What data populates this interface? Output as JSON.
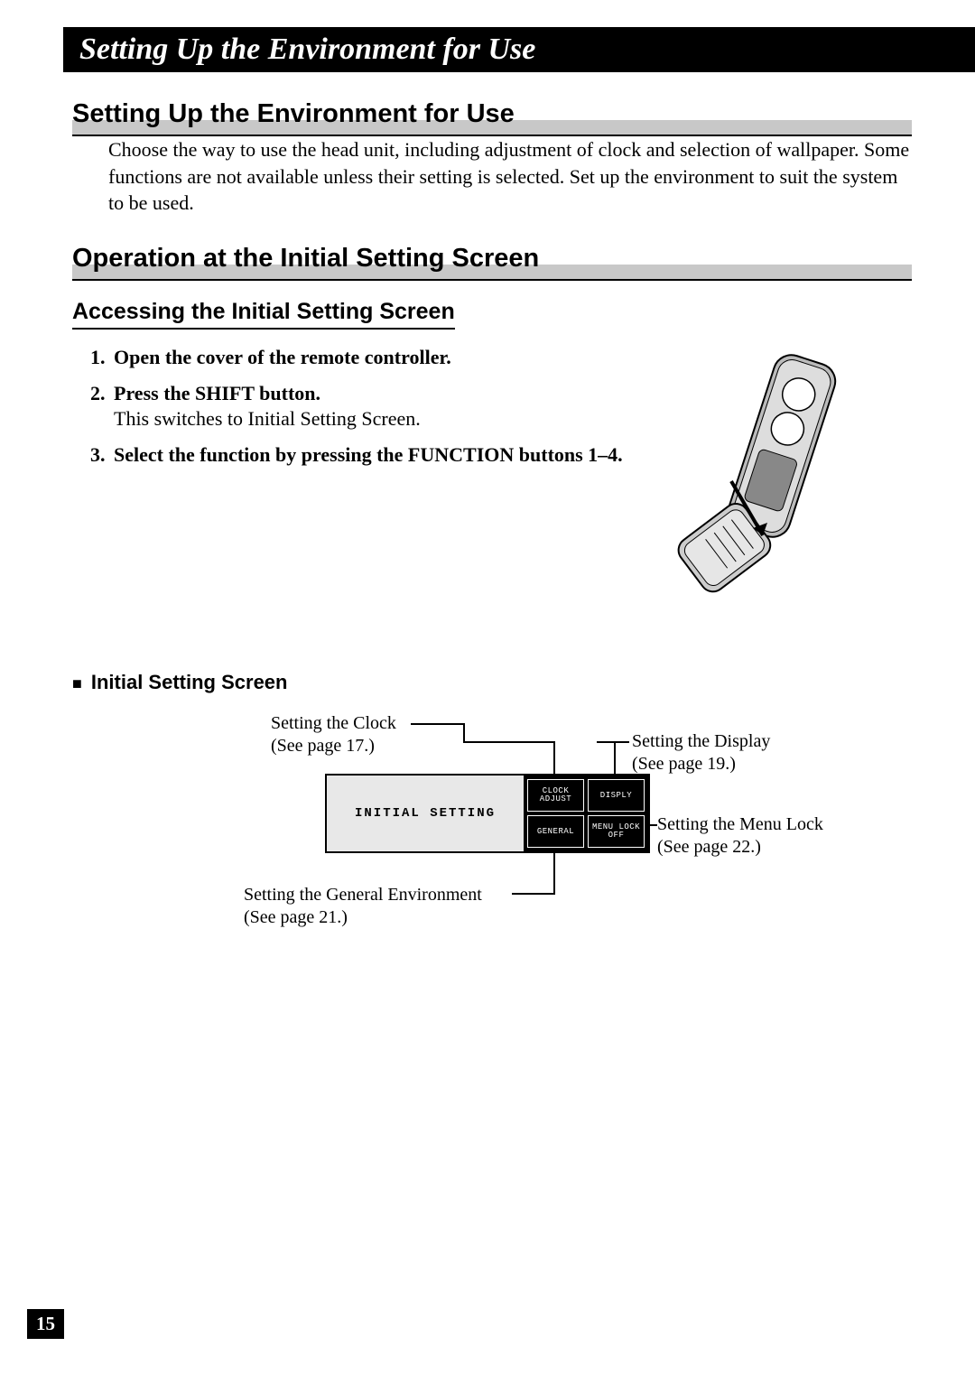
{
  "banner_title": "Setting Up the Environment for Use",
  "section1": {
    "heading": "Setting Up the Environment for Use",
    "body": "Choose the way to use the head unit, including adjustment of clock and selection of wallpaper. Some functions are not available unless their setting is selected. Set up the environment to suit the system to be used."
  },
  "section2": {
    "heading": "Operation at the Initial Setting Screen",
    "subheading": "Accessing the Initial Setting Screen",
    "steps": [
      {
        "num": "1.",
        "head": "Open the cover of the remote controller.",
        "body": ""
      },
      {
        "num": "2.",
        "head": "Press the SHIFT button.",
        "body": "This switches to Initial Setting Screen."
      },
      {
        "num": "3.",
        "head": "Select the function by pressing the FUNCTION buttons 1–4.",
        "body": ""
      }
    ],
    "bullet_heading": "Initial Setting Screen"
  },
  "diagram": {
    "panel_label": "INITIAL SETTING",
    "tiles": {
      "clock": "CLOCK\nADJUST",
      "display": "DISPLY",
      "general": "GENERAL",
      "menulock": "MENU LOCK\nOFF"
    },
    "callouts": {
      "clock": {
        "text": "Setting the Clock",
        "ref": "(See page 17.)"
      },
      "display": {
        "text": "Setting the Display",
        "ref": "(See page 19.)"
      },
      "menulock": {
        "text": "Setting the Menu Lock",
        "ref": "(See page 22.)"
      },
      "general": {
        "text": "Setting the General Environment",
        "ref": "(See page 21.)"
      }
    }
  },
  "page_number": "15"
}
